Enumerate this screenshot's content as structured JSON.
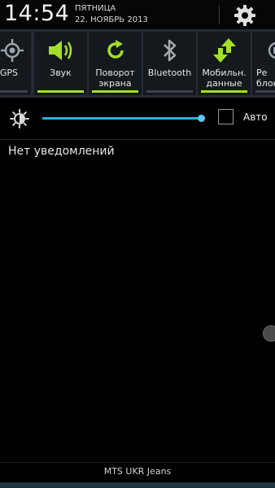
{
  "header": {
    "time": "14:54",
    "day": "ПЯТНИЦА",
    "date": "22. НОЯБРЬ 2013",
    "settings_icon": "gear-icon"
  },
  "toggles": [
    {
      "label": "GPS",
      "icon": "gps-icon",
      "active": false
    },
    {
      "label": "Звук",
      "icon": "speaker-icon",
      "active": true
    },
    {
      "label": "Поворот\nэкрана",
      "icon": "rotate-icon",
      "active": true
    },
    {
      "label": "Bluetooth",
      "icon": "bluetooth-icon",
      "active": false
    },
    {
      "label": "Мобильн.\nданные",
      "icon": "mobile-data-icon",
      "active": true
    },
    {
      "label": "Ре\nблок",
      "icon": "reading-mode-icon",
      "active": false
    }
  ],
  "brightness": {
    "level": 1.0,
    "auto_label": "Авто",
    "auto_checked": false,
    "icon": "brightness-icon"
  },
  "notifications": {
    "empty_text": "Нет уведомлений"
  },
  "footer": {
    "carrier": "MTS UKR Jeans"
  },
  "colors": {
    "accent_green": "#a2e02a",
    "slider_blue": "#36aed8",
    "toggle_bg": "#14191e",
    "panel_bg": "#252c33"
  }
}
